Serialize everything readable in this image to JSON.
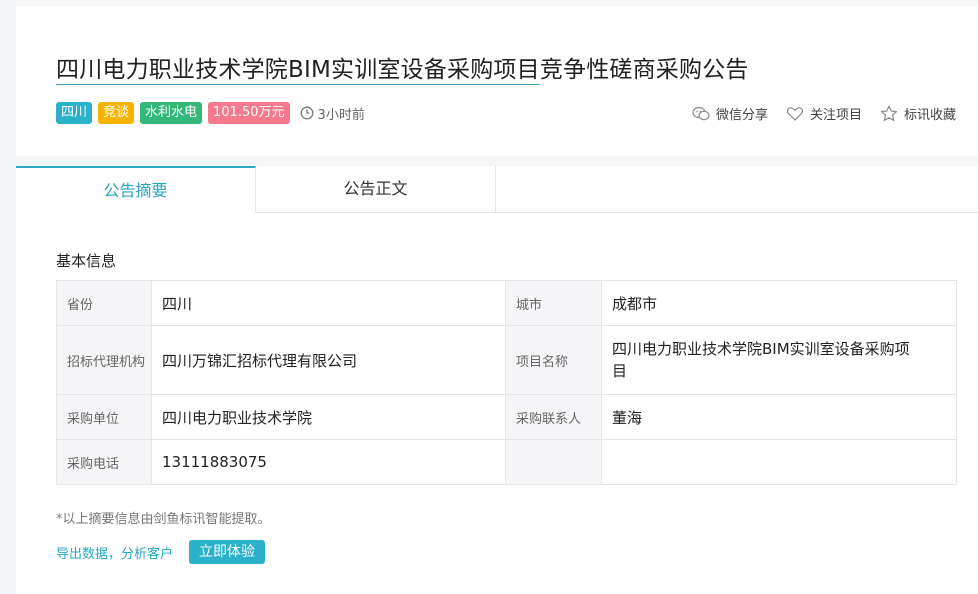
{
  "header": {
    "title_part1": "四川电力职业技术学院BIM实训室设备采购项目",
    "title_part2": "竞争性磋商采购公告",
    "tags": [
      "四川",
      "竞谈",
      "水利水电",
      "101.50万元"
    ],
    "time": "3小时前",
    "actions": {
      "share": "微信分享",
      "follow": "关注项目",
      "collect": "标讯收藏"
    }
  },
  "tabs": [
    "公告摘要",
    "公告正文"
  ],
  "section_title": "基本信息",
  "info_rows": [
    {
      "k1": "省份",
      "v1": "四川",
      "k2": "城市",
      "v2": "成都市"
    },
    {
      "k1": "招标代理机构",
      "v1": "四川万锦汇招标代理有限公司",
      "k2": "项目名称",
      "v2": "四川电力职业技术学院BIM实训室设备采购项目"
    },
    {
      "k1": "采购单位",
      "v1": "四川电力职业技术学院",
      "k2": "采购联系人",
      "v2": "董海"
    },
    {
      "k1": "采购电话",
      "v1": "13111883075",
      "k2": "",
      "v2": ""
    }
  ],
  "note": "*以上摘要信息由剑鱼标讯智能提取。",
  "cta": {
    "link": "导出数据，分析客户",
    "button": "立即体验"
  },
  "colors": {
    "accent": "#2aa6c1",
    "tag_yellow": "#f5b400",
    "tag_green": "#33b87a",
    "tag_pink": "#f57a8c"
  }
}
